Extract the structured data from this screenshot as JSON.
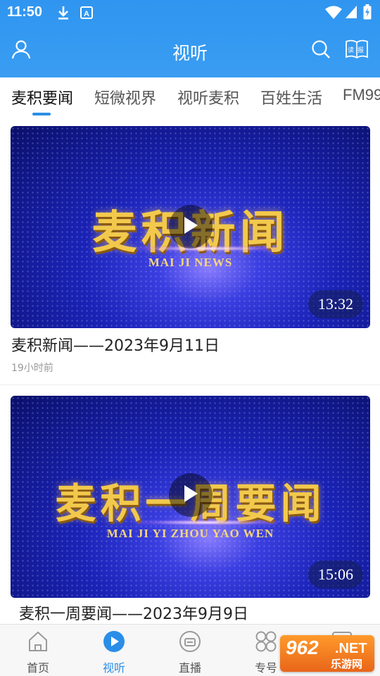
{
  "status_bar": {
    "time": "11:50"
  },
  "toolbar": {
    "title": "视听",
    "read_icon_text": "读报"
  },
  "tabs": [
    {
      "label": "麦积要闻",
      "active": true
    },
    {
      "label": "短微视界",
      "active": false
    },
    {
      "label": "视听麦积",
      "active": false
    },
    {
      "label": "百姓生活",
      "active": false
    },
    {
      "label": "FM99",
      "active": false
    }
  ],
  "videos": [
    {
      "thumb_title": "麦积新闻",
      "thumb_subtitle": "MAI JI NEWS",
      "duration": "13:32",
      "title": "麦积新闻——2023年9月11日",
      "time": "19小时前"
    },
    {
      "thumb_title": "麦积一周要闻",
      "thumb_subtitle": "MAI JI YI ZHOU YAO WEN",
      "duration": "15:06",
      "title": "麦积一周要闻——2023年9月9日"
    }
  ],
  "bottom_nav": [
    {
      "label": "首页",
      "icon": "home-icon",
      "active": false
    },
    {
      "label": "视听",
      "icon": "play-circle-icon",
      "active": true
    },
    {
      "label": "直播",
      "icon": "tv-icon",
      "active": false
    },
    {
      "label": "专号",
      "icon": "four-circles-icon",
      "active": false
    },
    {
      "label": "",
      "icon": "star-badge-icon",
      "active": false
    }
  ],
  "watermark": {
    "number": "962",
    "suffix": ".NET",
    "text": "乐游网"
  },
  "colors": {
    "header_blue": "#3a9df2",
    "accent": "#2a8ee8",
    "gold": "#f2c94c",
    "watermark_orange": "#ff9a2a"
  }
}
